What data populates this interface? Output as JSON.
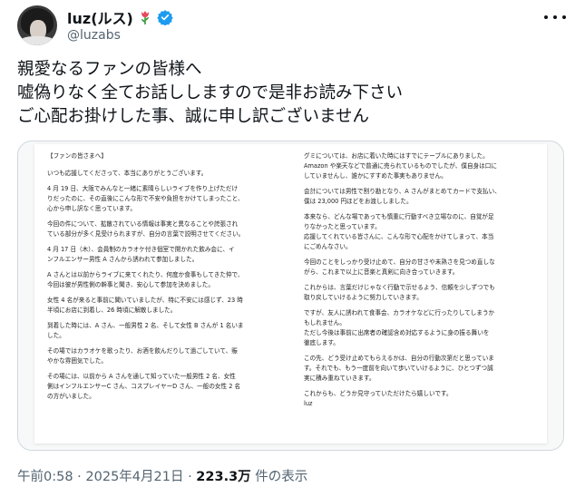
{
  "author": {
    "display_name": "luz(ルス)",
    "handle": "@luzabs",
    "verified": true,
    "name_emoji_icon": "tulip-flower-icon",
    "badge_icon": "verified-badge-icon",
    "badge_color": "#1d9bf0"
  },
  "menu": {
    "icon": "more-dots-icon"
  },
  "tweet": {
    "lines": [
      "親愛なるファンの皆様へ",
      "嘘偽りなく全てお話ししますので是非お読み下さい",
      "ご心配お掛けした事、誠に申し訳ございません"
    ]
  },
  "letter": {
    "left": [
      "【ファンの皆さまへ】",
      "いつも応援してくださって、本当にありがとうございます。",
      "4 月 19 日、大阪でみんなと一緒に素晴らしいライブを作り上げただけ\nりだったのに、その直後にこんな形で不安や負担をかけてしまったこと、\n心から申し訳なく思っています。",
      "今回の件について、拡散されている情報は事実と異なることや誇張され\nている部分が多く見受けられますが、自分の言葉で説明させてください。",
      "4 月 17 日（木）、会員制のカラオケ付き個室で開かれた飲み会に、イ\nンフルエンサー男性 A さんから誘われて参加しました。",
      "A さんとは以前からライブに来てくれたり、何度か食事もしてきた仲で、\n今回は彼が男性側の幹事と聞き、安心して参加を決めました。",
      "女性 4 名が来ると事前に聞いていましたが、特に不安には感じず、23 時\n半頃にお店に到着し、26 時頃に解散しました。",
      "到着した時には、A さん、一般男性 2 名、そして女性 B さんが 1 名いま\nした。",
      "その場ではカラオケを歌ったり、お酒を飲んだりして過ごしていて、賑\nやかな雰囲気でした。",
      "その場には、以前から A さんを通して知っていた一般男性 2 名、女性\n側はインフルエンサーC さん、コスプレイヤーD さん、一般の女性 2 名\nの方がいました。"
    ],
    "right": [
      "グミについては、お店に着いた時にはすでにテーブルにありました。\nAmazon や楽天などで普通に売られているものでしたが、僕自身は口に\nしていませんし、誰かにすすめた事実もありません。",
      "会計については男性で割り勘となり、A さんがまとめてカードで支払い、\n僕は 23,000 円ほどをお渡ししました。",
      "本来なら、どんな場であっても慎重に行動すべき立場なのに、自覚が足\nりなかったと思っています。\n応援してくれている皆さんに、こんな形で心配をかけてしまって、本当\nにごめんなさい。",
      "今回のことをしっかり受け止めて、自分の甘さや未熟さを見つめ直しな\nがら、これまで以上に音楽と真剣に向き合っていきます。",
      "これからは、言葉だけじゃなく行動で示せるよう、信頼を少しずつでも\n取り戻していけるように努力していきます。",
      "ですが、友人に誘われて食事会、カラオケなどに行ったりしてしまうか\nもしれません。\nただし今後は事前に出席者の確認含め対応するように身の振る舞いを\n徹底します。",
      "この先、どう受け止めてもらえるかは、自分の行動次第だと思っていま\nす。それでも、もう一度前を向いて歩いていけるように、ひとつずつ誠\n実に積み重ねていきます。",
      "これからも、どうか見守っていただけたら嬉しいです。\nluz"
    ]
  },
  "meta": {
    "time": "午前0:58",
    "separator": "·",
    "date": "2025年4月21日",
    "views_count": "223.3万",
    "views_label": " 件の表示"
  }
}
